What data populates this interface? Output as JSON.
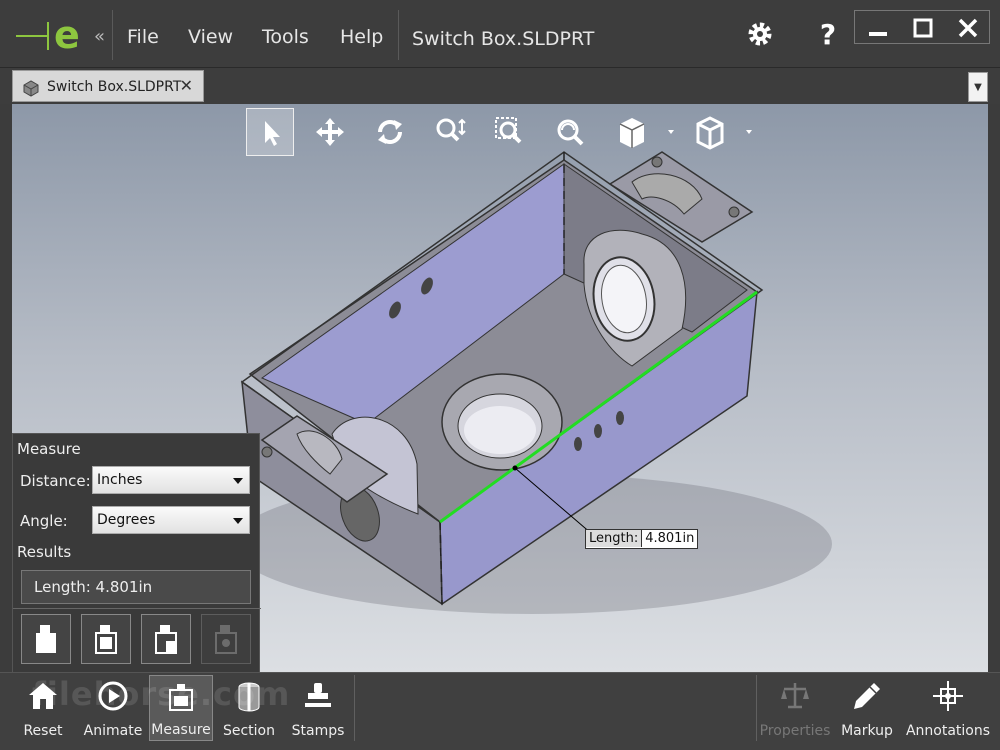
{
  "app": {
    "menu": {
      "file": "File",
      "view": "View",
      "tools": "Tools",
      "help": "Help"
    },
    "document_title": "Switch Box.SLDPRT",
    "icons": {
      "logo": "edrawings-logo-icon",
      "collapse": "collapse-chevrons-icon",
      "settings": "gear-icon",
      "help": "question-icon",
      "minimize": "minimize-icon",
      "maximize": "maximize-icon",
      "close": "close-icon"
    },
    "collapse_glyph": "«",
    "help_glyph": "?"
  },
  "tabs": [
    {
      "label": "Switch Box.SLDPRT",
      "close_glyph": "✕",
      "icon": "part-file-icon"
    }
  ],
  "viewport_tools": [
    "select-arrow-icon",
    "pan-icon",
    "rotate-icon",
    "zoom-to-fit-icon",
    "zoom-to-area-icon",
    "zoom-icon",
    "view-orientation-icon",
    "display-style-icon"
  ],
  "viewport": {
    "measurement_callout": {
      "key": "Length:",
      "value": "4.801in"
    },
    "highlight_color": "#22dd22"
  },
  "measure_panel": {
    "title": "Measure",
    "distance_label": "Distance:",
    "distance_value": "Inches",
    "angle_label": "Angle:",
    "angle_value": "Degrees",
    "results_label": "Results",
    "result_text": "Length: 4.801in",
    "buttons": [
      "measure-mode-1-icon",
      "measure-mode-2-icon",
      "measure-mode-3-icon",
      "measure-mode-4-icon"
    ]
  },
  "bottom_toolbar": {
    "reset": "Reset",
    "animate": "Animate",
    "measure": "Measure",
    "section": "Section",
    "stamps": "Stamps",
    "properties": "Properties",
    "markup": "Markup",
    "annotations": "Annotations",
    "watermark": "filehorse.com"
  }
}
